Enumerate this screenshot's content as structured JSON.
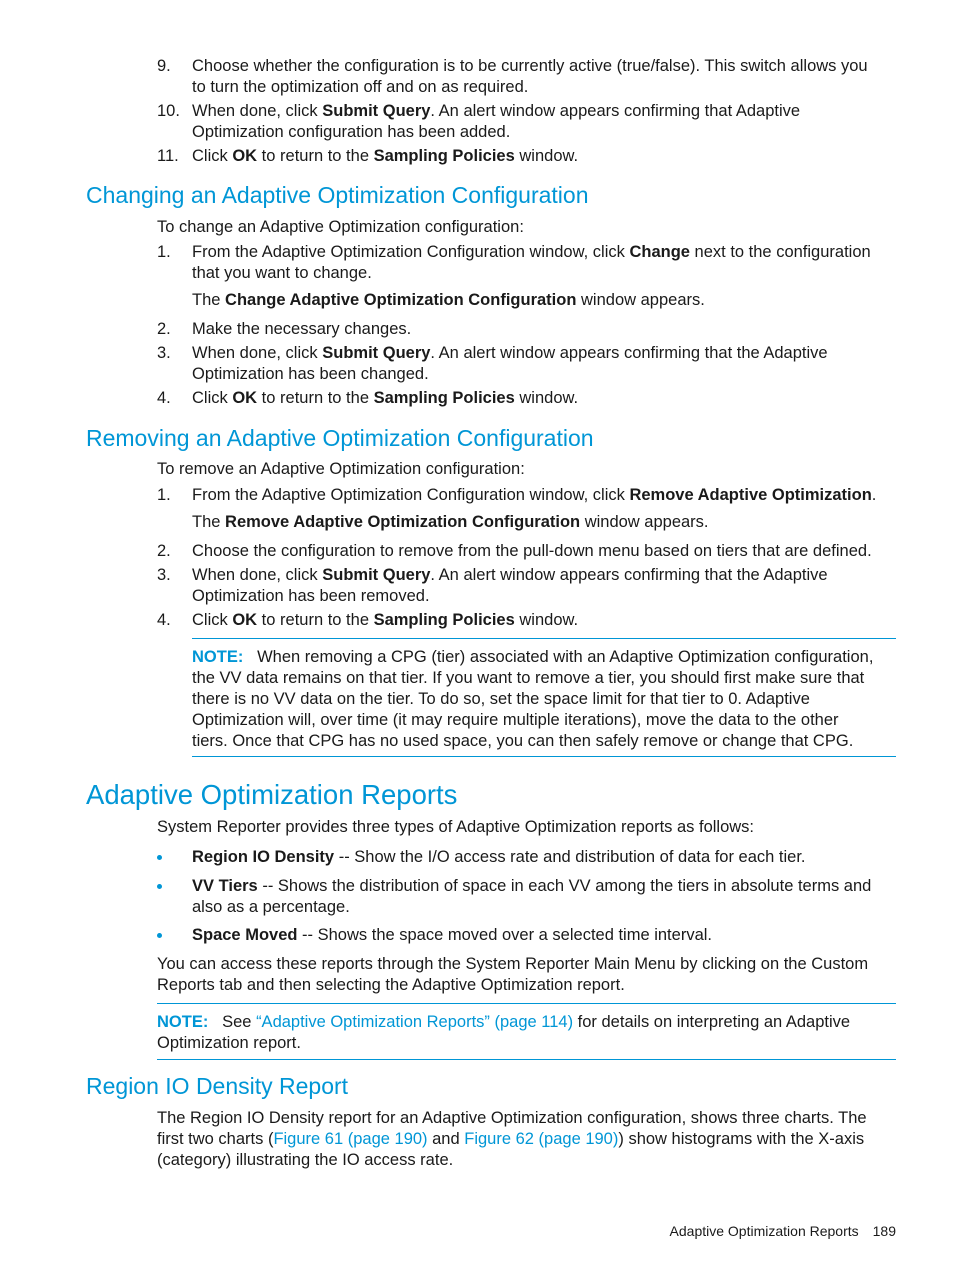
{
  "top_list": [
    {
      "num": "9.",
      "line1": "Choose whether the configuration is to be currently active (true/false). This switch allows you",
      "line2": "to turn the optimization off and on as required."
    },
    {
      "num": "10.",
      "pre": "When done, click ",
      "bold": "Submit Query",
      "post": ". An alert window appears confirming that Adaptive",
      "line2": "Optimization configuration has been added."
    },
    {
      "num": "11.",
      "pre": "Click ",
      "bold": "OK",
      "mid": " to return to the ",
      "bold2": "Sampling Policies",
      "post": " window."
    }
  ],
  "changing": {
    "heading": "Changing an Adaptive Optimization Configuration",
    "intro": "To change an Adaptive Optimization configuration:",
    "steps": [
      {
        "num": "1.",
        "pre": "From the Adaptive Optimization Configuration window, click ",
        "bold": "Change",
        "post": " next to the configuration",
        "line2": "that you want to change."
      },
      {
        "pre": "The ",
        "bold": "Change Adaptive Optimization Configuration",
        "post": " window appears."
      },
      {
        "num": "2.",
        "text": "Make the necessary changes."
      },
      {
        "num": "3.",
        "pre": "When done, click ",
        "bold": "Submit Query",
        "post": ". An alert window appears confirming that the Adaptive",
        "line2": "Optimization has been changed."
      },
      {
        "num": "4.",
        "pre": "Click ",
        "bold": "OK",
        "mid": " to return to the ",
        "bold2": "Sampling Policies",
        "post": " window."
      }
    ]
  },
  "removing": {
    "heading": "Removing an Adaptive Optimization Configuration",
    "intro": "To remove an Adaptive Optimization configuration:",
    "steps": [
      {
        "num": "1.",
        "pre": "From the Adaptive Optimization Configuration window, click ",
        "bold": "Remove Adaptive Optimization",
        "post": "."
      },
      {
        "pre": "The ",
        "bold": "Remove Adaptive Optimization Configuration",
        "post": " window appears."
      },
      {
        "num": "2.",
        "text": "Choose the configuration to remove from the pull-down menu based on tiers that are defined."
      },
      {
        "num": "3.",
        "pre": "When done, click ",
        "bold": "Submit Query",
        "post": ". An alert window appears confirming that the Adaptive",
        "line2": "Optimization has been removed."
      },
      {
        "num": "4.",
        "pre": "Click ",
        "bold": "OK",
        "mid": " to return to the ",
        "bold2": "Sampling Policies",
        "post": " window."
      }
    ],
    "note": {
      "label": "NOTE:",
      "lines": [
        "When removing a CPG (tier) associated with an Adaptive Optimization configuration,",
        "the VV data remains on that tier. If you want to remove a tier, you should first make sure that",
        "there is no VV data on the tier. To do so, set the space limit for that tier to 0. Adaptive",
        "Optimization will, over time (it may require multiple iterations), move the data to the other",
        "tiers. Once that CPG has no used space, you can then safely remove or change that CPG."
      ]
    }
  },
  "reports": {
    "heading": "Adaptive Optimization Reports",
    "intro": "System Reporter provides three types of Adaptive Optimization reports as follows:",
    "bullets": [
      {
        "bold": "Region IO Density",
        "text": " -- Show the I/O access rate and distribution of data for each tier."
      },
      {
        "bold": "VV Tiers",
        "text": " -- Shows the distribution of space in each VV among the tiers in absolute terms and",
        "line2": "also as a percentage."
      },
      {
        "bold": "Space Moved",
        "text": " -- Shows the space moved over a selected time interval."
      }
    ],
    "access_line1": "You can access these reports through the System Reporter Main Menu by clicking on the Custom",
    "access_line2": "Reports tab and then selecting the Adaptive Optimization report.",
    "note": {
      "label": "NOTE:",
      "pre": "See ",
      "link": "“Adaptive Optimization Reports” (page 114)",
      "post": " for details on interpreting an Adaptive",
      "line2": "Optimization report."
    }
  },
  "region": {
    "heading": "Region IO Density Report",
    "line1": "The Region IO Density report for an Adaptive Optimization configuration, shows three charts. The",
    "line2_pre": "first two charts (",
    "link1": "Figure 61 (page 190)",
    "line2_mid": " and ",
    "link2": "Figure 62 (page 190)",
    "line2_post": ") show histograms with the X-axis",
    "line3": "(category) illustrating the IO access rate."
  },
  "footer": {
    "section": "Adaptive Optimization Reports",
    "page": "189"
  }
}
